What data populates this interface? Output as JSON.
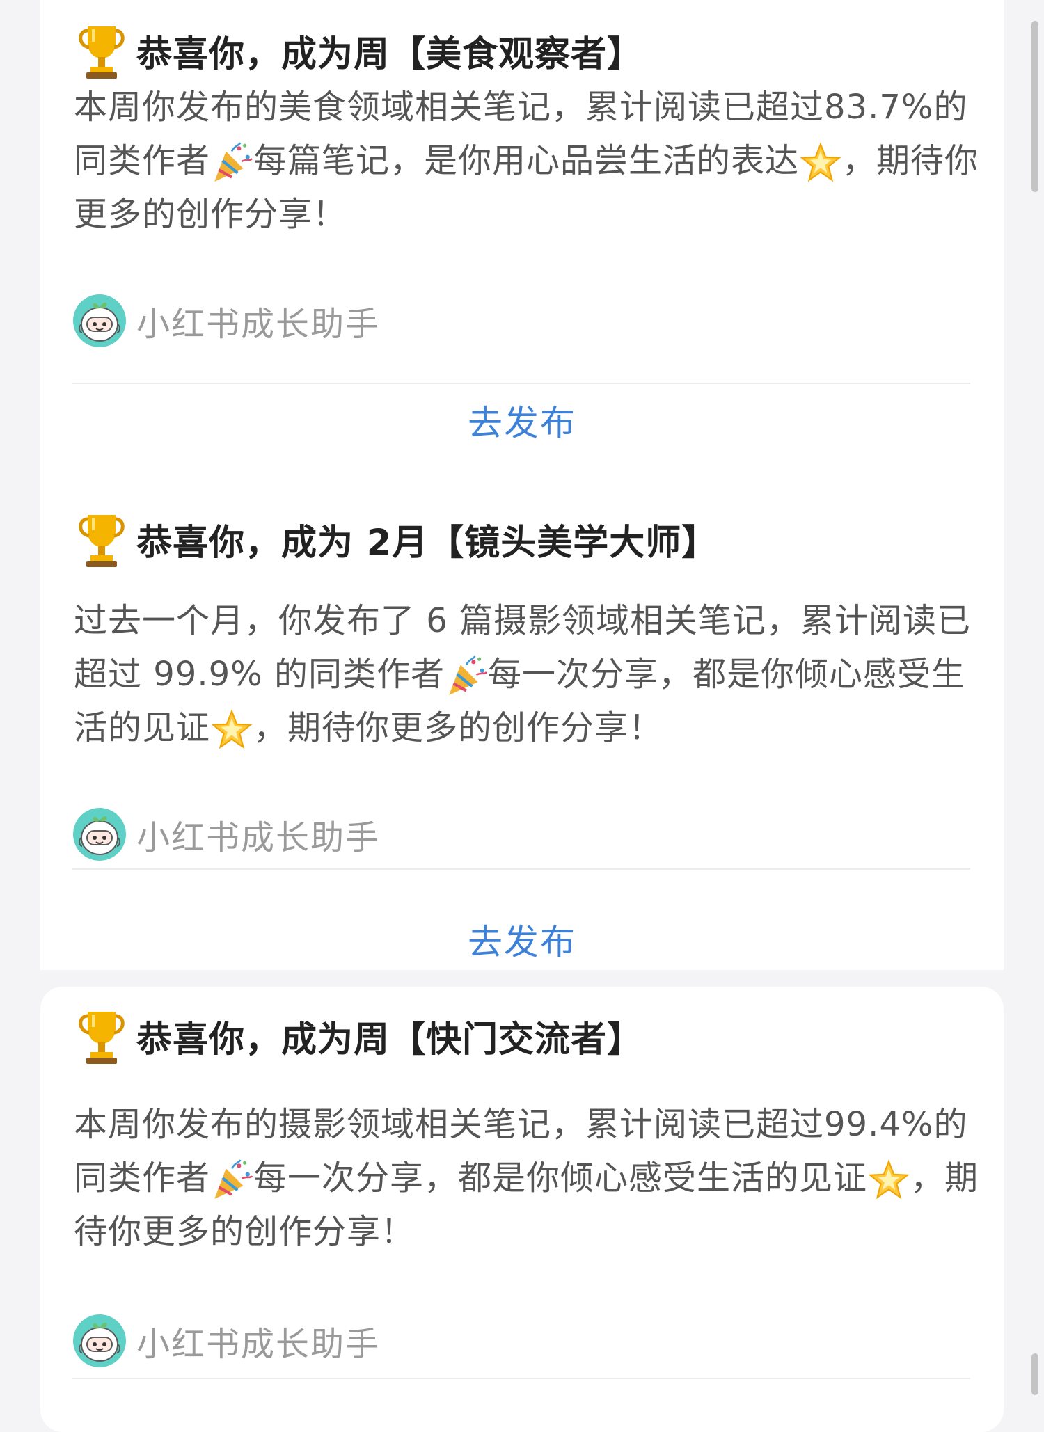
{
  "cards": [
    {
      "title": "恭喜你，成为周【美食观察者】",
      "body_part1": "本周你发布的美食领域相关笔记，累计阅读已超过83.7%的同类作者",
      "body_part2": "每篇笔记，是你用心品尝生活的表达",
      "body_part3": "，期待你更多的创作分享！",
      "sender": "小红书成长助手",
      "action": "去发布"
    },
    {
      "title": "恭喜你，成为 2月【镜头美学大师】",
      "body_part1": "过去一个月，你发布了 6 篇摄影领域相关笔记，累计阅读已超过 99.9% 的同类作者",
      "body_part2": "每一次分享，都是你倾心感受生活的见证",
      "body_part3": "，期待你更多的创作分享！",
      "sender": "小红书成长助手",
      "action": "去发布"
    },
    {
      "title": "恭喜你，成为周【快门交流者】",
      "body_part1": "本周你发布的摄影领域相关笔记，累计阅读已超过99.4%的同类作者",
      "body_part2": "每一次分享，都是你倾心感受生活的见证",
      "body_part3": "，期待你更多的创作分享！",
      "sender": "小红书成长助手"
    }
  ],
  "icons": {
    "trophy": "trophy-icon",
    "party_popper": "party-popper-icon",
    "star": "glowing-star-icon",
    "avatar": "growth-assistant-avatar"
  },
  "colors": {
    "action": "#3d82d8",
    "title": "#222222",
    "body": "#555555",
    "sender": "#9a9a9a"
  }
}
